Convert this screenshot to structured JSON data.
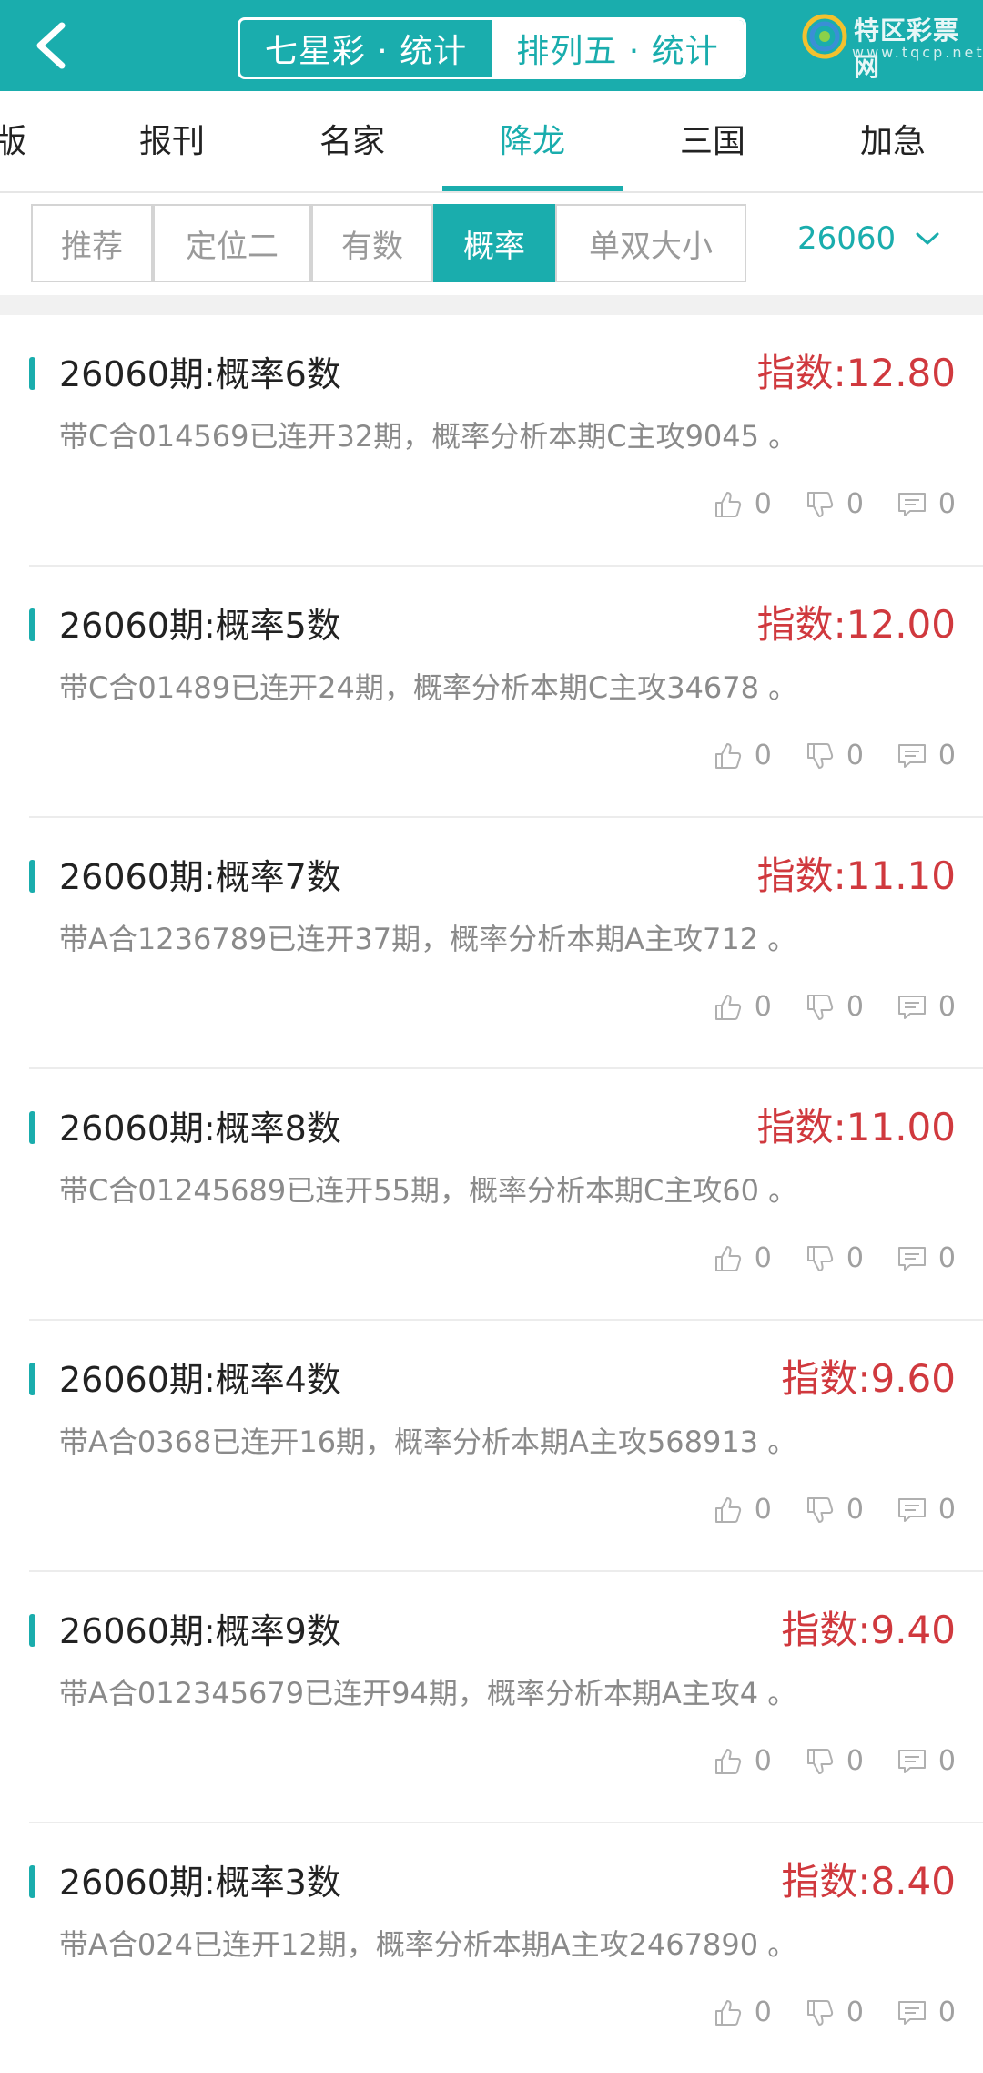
{
  "header": {
    "tabs": [
      "七星彩 · 统计",
      "排列五 · 统计"
    ],
    "logo_text": "特区彩票网",
    "logo_sub": "www.tqcp.net"
  },
  "nav": {
    "items": [
      "版",
      "报刊",
      "名家",
      "降龙",
      "三国",
      "加急"
    ],
    "active": "降龙"
  },
  "filters": {
    "chips": [
      "推荐",
      "定位二",
      "有数",
      "概率",
      "单双大小"
    ],
    "active": "概率",
    "period": "26060"
  },
  "list": [
    {
      "title": "26060期:概率6数",
      "index": "指数:12.80",
      "desc": "带C合014569已连开32期，概率分析本期C主攻9045 。",
      "likes": "0",
      "dislikes": "0",
      "comments": "0"
    },
    {
      "title": "26060期:概率5数",
      "index": "指数:12.00",
      "desc": "带C合01489已连开24期，概率分析本期C主攻34678 。",
      "likes": "0",
      "dislikes": "0",
      "comments": "0"
    },
    {
      "title": "26060期:概率7数",
      "index": "指数:11.10",
      "desc": "带A合1236789已连开37期，概率分析本期A主攻712 。",
      "likes": "0",
      "dislikes": "0",
      "comments": "0"
    },
    {
      "title": "26060期:概率8数",
      "index": "指数:11.00",
      "desc": "带C合01245689已连开55期，概率分析本期C主攻60 。",
      "likes": "0",
      "dislikes": "0",
      "comments": "0"
    },
    {
      "title": "26060期:概率4数",
      "index": "指数:9.60",
      "desc": "带A合0368已连开16期，概率分析本期A主攻568913 。",
      "likes": "0",
      "dislikes": "0",
      "comments": "0"
    },
    {
      "title": "26060期:概率9数",
      "index": "指数:9.40",
      "desc": "带A合012345679已连开94期，概率分析本期A主攻4 。",
      "likes": "0",
      "dislikes": "0",
      "comments": "0"
    },
    {
      "title": "26060期:概率3数",
      "index": "指数:8.40",
      "desc": "带A合024已连开12期，概率分析本期A主攻2467890 。",
      "likes": "0",
      "dislikes": "0",
      "comments": "0"
    }
  ],
  "colors": {
    "accent": "#1aadad",
    "index_red": "#d0393e"
  }
}
